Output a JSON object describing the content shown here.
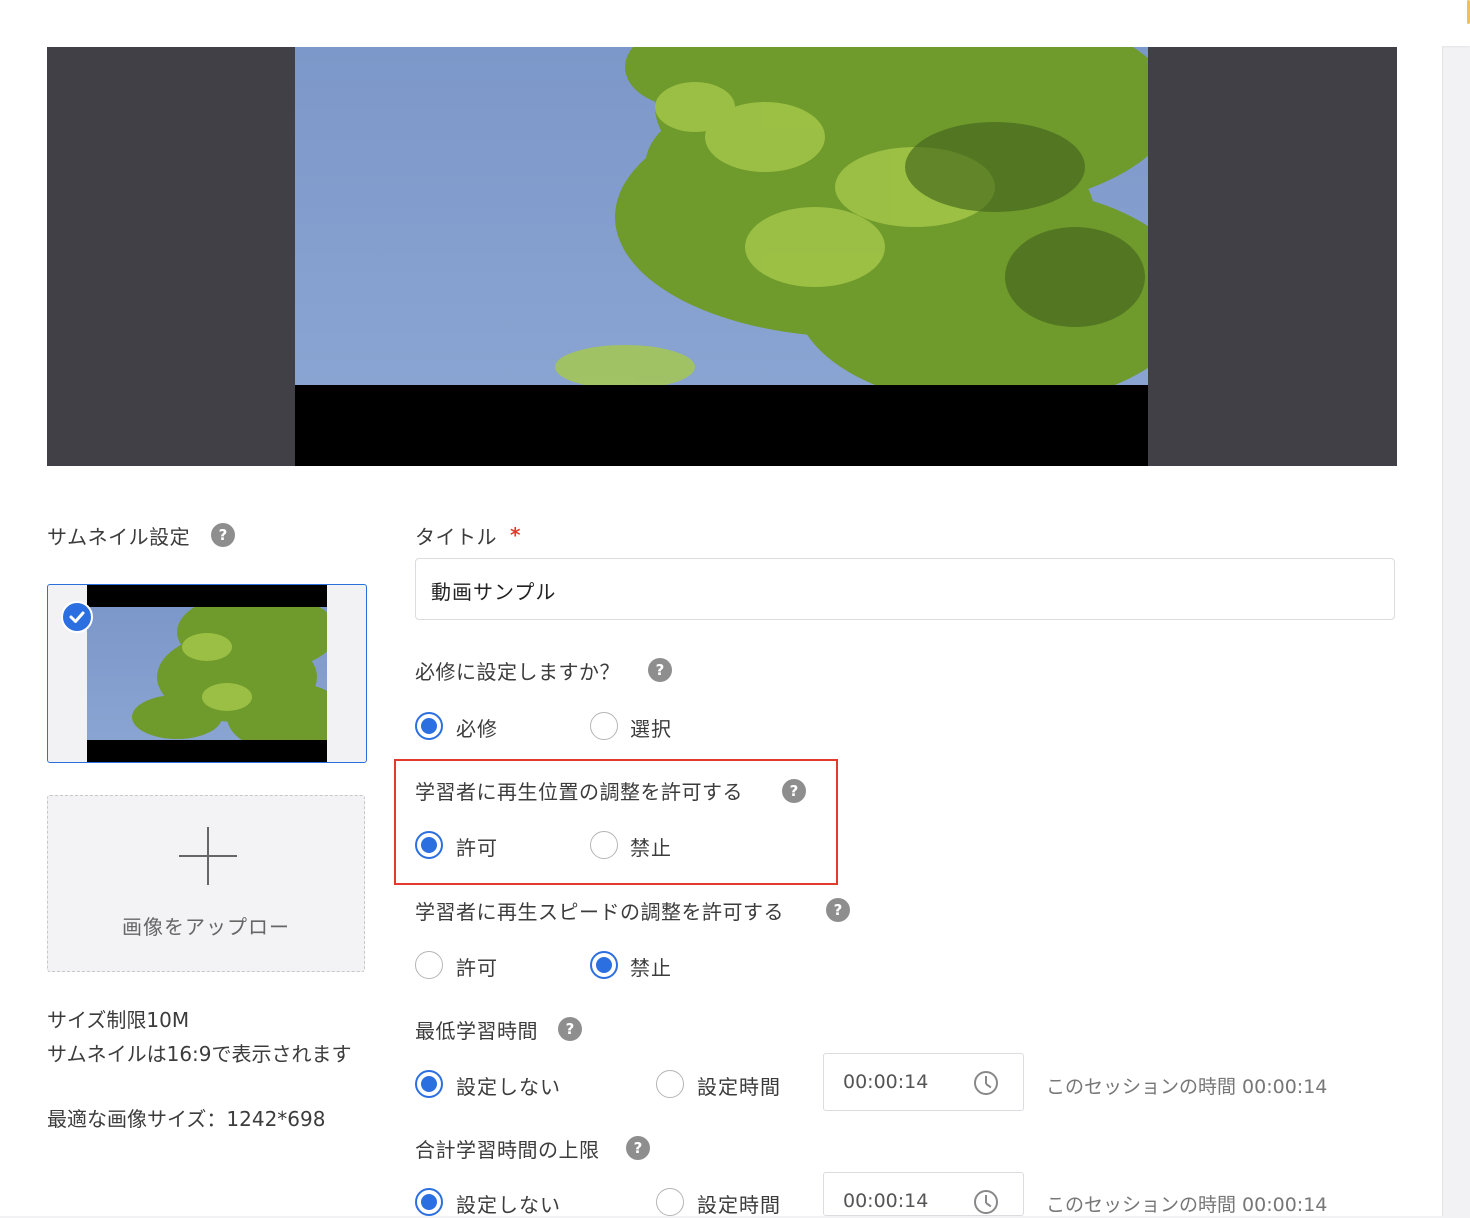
{
  "thumbnail_section": {
    "label": "サムネイル設定",
    "upload_label": "画像をアップロー",
    "size_limit": "サイズ制限10M",
    "ratio_note": "サムネイルは16:9で表示されます",
    "optimal_size": "最適な画像サイズ：1242*698"
  },
  "title_field": {
    "label": "タイトル",
    "required_mark": "*",
    "value": "動画サンプル"
  },
  "required_setting": {
    "label": "必修に設定しますか？",
    "options": [
      "必修",
      "選択"
    ],
    "selected": "必修"
  },
  "seek_permission": {
    "label": "学習者に再生位置の調整を許可する",
    "options": [
      "許可",
      "禁止"
    ],
    "selected": "許可"
  },
  "speed_permission": {
    "label": "学習者に再生スピードの調整を許可する",
    "options": [
      "許可",
      "禁止"
    ],
    "selected": "禁止"
  },
  "min_study_time": {
    "label": "最低学習時間",
    "options": [
      "設定しない",
      "設定時間"
    ],
    "selected": "設定しない",
    "time_value": "00:00:14",
    "session_time": "このセッションの時間 00:00:14"
  },
  "max_study_time": {
    "label": "合計学習時間の上限",
    "options": [
      "設定しない",
      "設定時間"
    ],
    "selected": "設定しない",
    "time_value": "00:00:14",
    "session_time": "このセッションの時間 00:00:14"
  },
  "help_symbol": "?",
  "colors": {
    "accent": "#2c6fe0",
    "highlight": "#e23b2e",
    "video_bg": "#404046",
    "sky": "#7c97c9",
    "foliage": "#6f9a2c"
  },
  "icons": [
    "help-icon",
    "check-icon",
    "plus-icon",
    "clock-icon"
  ]
}
